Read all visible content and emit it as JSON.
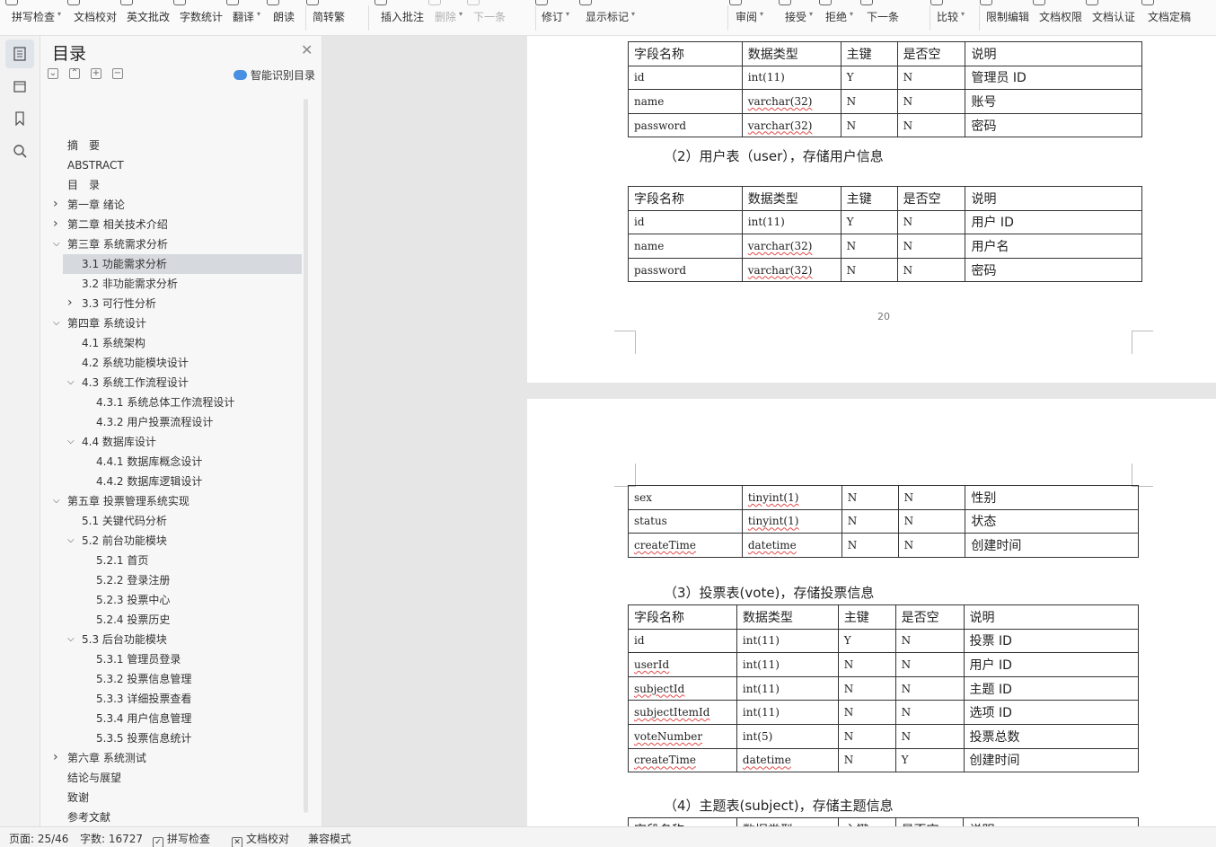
{
  "ribbon": {
    "items": [
      {
        "label": "拼写检查",
        "dropdown": true,
        "enabled": true
      },
      {
        "label": "文档校对",
        "dropdown": false,
        "enabled": true
      },
      {
        "label": "英文批改",
        "dropdown": false,
        "enabled": true
      },
      {
        "label": "字数统计",
        "dropdown": false,
        "enabled": true
      },
      {
        "label": "翻译",
        "dropdown": true,
        "enabled": true
      },
      {
        "label": "朗读",
        "dropdown": false,
        "enabled": true
      },
      {
        "label": "简转繁",
        "dropdown": false,
        "enabled": true
      },
      {
        "label": "插入批注",
        "dropdown": false,
        "enabled": true
      },
      {
        "label": "删除",
        "dropdown": true,
        "enabled": false
      },
      {
        "label": "下一条",
        "dropdown": false,
        "enabled": false
      },
      {
        "label": "修订",
        "dropdown": true,
        "enabled": true
      },
      {
        "label": "显示标记",
        "dropdown": true,
        "enabled": true
      },
      {
        "label": "审阅",
        "dropdown": true,
        "enabled": true
      },
      {
        "label": "接受",
        "dropdown": true,
        "enabled": true
      },
      {
        "label": "拒绝",
        "dropdown": true,
        "enabled": true
      },
      {
        "label": "下一条",
        "dropdown": false,
        "enabled": true
      },
      {
        "label": "比较",
        "dropdown": true,
        "enabled": true
      },
      {
        "label": "限制编辑",
        "dropdown": false,
        "enabled": true
      },
      {
        "label": "文档权限",
        "dropdown": false,
        "enabled": true
      },
      {
        "label": "文档认证",
        "dropdown": false,
        "enabled": true
      },
      {
        "label": "文档定稿",
        "dropdown": false,
        "enabled": true
      }
    ]
  },
  "toc": {
    "title": "目录",
    "smart_label": "智能识别目录",
    "items": [
      {
        "label": "摘　要",
        "level": 0,
        "arrow": ""
      },
      {
        "label": "ABSTRACT",
        "level": 0,
        "arrow": ""
      },
      {
        "label": "目　录",
        "level": 0,
        "arrow": ""
      },
      {
        "label": "第一章  绪论",
        "level": 0,
        "arrow": "collapsed"
      },
      {
        "label": "第二章  相关技术介绍",
        "level": 0,
        "arrow": "collapsed"
      },
      {
        "label": "第三章  系统需求分析",
        "level": 0,
        "arrow": "expanded"
      },
      {
        "label": "3.1  功能需求分析",
        "level": 1,
        "arrow": "",
        "selected": true
      },
      {
        "label": "3.2  非功能需求分析",
        "level": 1,
        "arrow": ""
      },
      {
        "label": "3.3  可行性分析",
        "level": 1,
        "arrow": "collapsed"
      },
      {
        "label": "第四章  系统设计",
        "level": 0,
        "arrow": "expanded"
      },
      {
        "label": "4.1  系统架构",
        "level": 1,
        "arrow": ""
      },
      {
        "label": "4.2  系统功能模块设计",
        "level": 1,
        "arrow": ""
      },
      {
        "label": "4.3  系统工作流程设计",
        "level": 1,
        "arrow": "expanded"
      },
      {
        "label": "4.3.1  系统总体工作流程设计",
        "level": 2,
        "arrow": ""
      },
      {
        "label": "4.3.2  用户投票流程设计",
        "level": 2,
        "arrow": ""
      },
      {
        "label": "4.4  数据库设计",
        "level": 1,
        "arrow": "expanded"
      },
      {
        "label": "4.4.1  数据库概念设计",
        "level": 2,
        "arrow": ""
      },
      {
        "label": "4.4.2  数据库逻辑设计",
        "level": 2,
        "arrow": ""
      },
      {
        "label": "第五章  投票管理系统实现",
        "level": 0,
        "arrow": "expanded"
      },
      {
        "label": "5.1  关键代码分析",
        "level": 1,
        "arrow": ""
      },
      {
        "label": "5.2  前台功能模块",
        "level": 1,
        "arrow": "expanded"
      },
      {
        "label": "5.2.1  首页",
        "level": 2,
        "arrow": ""
      },
      {
        "label": "5.2.2  登录注册",
        "level": 2,
        "arrow": ""
      },
      {
        "label": "5.2.3  投票中心",
        "level": 2,
        "arrow": ""
      },
      {
        "label": "5.2.4  投票历史",
        "level": 2,
        "arrow": ""
      },
      {
        "label": "5.3  后台功能模块",
        "level": 1,
        "arrow": "expanded"
      },
      {
        "label": "5.3.1  管理员登录",
        "level": 2,
        "arrow": ""
      },
      {
        "label": "5.3.2  投票信息管理",
        "level": 2,
        "arrow": ""
      },
      {
        "label": "5.3.3  详细投票查看",
        "level": 2,
        "arrow": ""
      },
      {
        "label": "5.3.4  用户信息管理",
        "level": 2,
        "arrow": ""
      },
      {
        "label": "5.3.5  投票信息统计",
        "level": 2,
        "arrow": ""
      },
      {
        "label": "第六章  系统测试",
        "level": 0,
        "arrow": "collapsed"
      },
      {
        "label": "结论与展望",
        "level": 0,
        "arrow": ""
      },
      {
        "label": "致谢",
        "level": 0,
        "arrow": ""
      },
      {
        "label": "参考文献",
        "level": 0,
        "arrow": ""
      }
    ]
  },
  "document": {
    "page1_number": "20",
    "header_row": [
      "字段名称",
      "数据类型",
      "主键",
      "是否空",
      "说明"
    ],
    "table_admin": [
      [
        "id",
        "int(11)",
        "Y",
        "N",
        "管理员 ID"
      ],
      [
        "name",
        "varchar(32)",
        "N",
        "N",
        "账号"
      ],
      [
        "password",
        "varchar(32)",
        "N",
        "N",
        "密码"
      ]
    ],
    "caption_user": "（2）用户表（user），存储用户信息",
    "table_user": [
      [
        "id",
        "int(11)",
        "Y",
        "N",
        "用户 ID"
      ],
      [
        "name",
        "varchar(32)",
        "N",
        "N",
        "用户名"
      ],
      [
        "password",
        "varchar(32)",
        "N",
        "N",
        "密码"
      ]
    ],
    "table_user_cont": [
      [
        "sex",
        "tinyint(1)",
        "N",
        "N",
        "性别"
      ],
      [
        "status",
        "tinyint(1)",
        "N",
        "N",
        "状态"
      ],
      [
        "createTime",
        "datetime",
        "N",
        "N",
        "创建时间"
      ]
    ],
    "caption_vote": "（3）投票表(vote)，存储投票信息",
    "table_vote": [
      [
        "id",
        "int(11)",
        "Y",
        "N",
        "投票 ID"
      ],
      [
        "userId",
        "int(11)",
        "N",
        "N",
        "用户 ID"
      ],
      [
        "subjectId",
        "int(11)",
        "N",
        "N",
        "主题 ID"
      ],
      [
        "subjectItemId",
        "int(11)",
        "N",
        "N",
        "选项 ID"
      ],
      [
        "voteNumber",
        "int(5)",
        "N",
        "N",
        "投票总数"
      ],
      [
        "createTime",
        "datetime",
        "N",
        "Y",
        "创建时间"
      ]
    ],
    "caption_subject": "（4）主题表(subject)，存储主题信息"
  },
  "status": {
    "page": "页面: 25/46",
    "words": "字数: 16727",
    "spell": "拼写检查",
    "proof": "文档校对",
    "compat": "兼容模式"
  }
}
